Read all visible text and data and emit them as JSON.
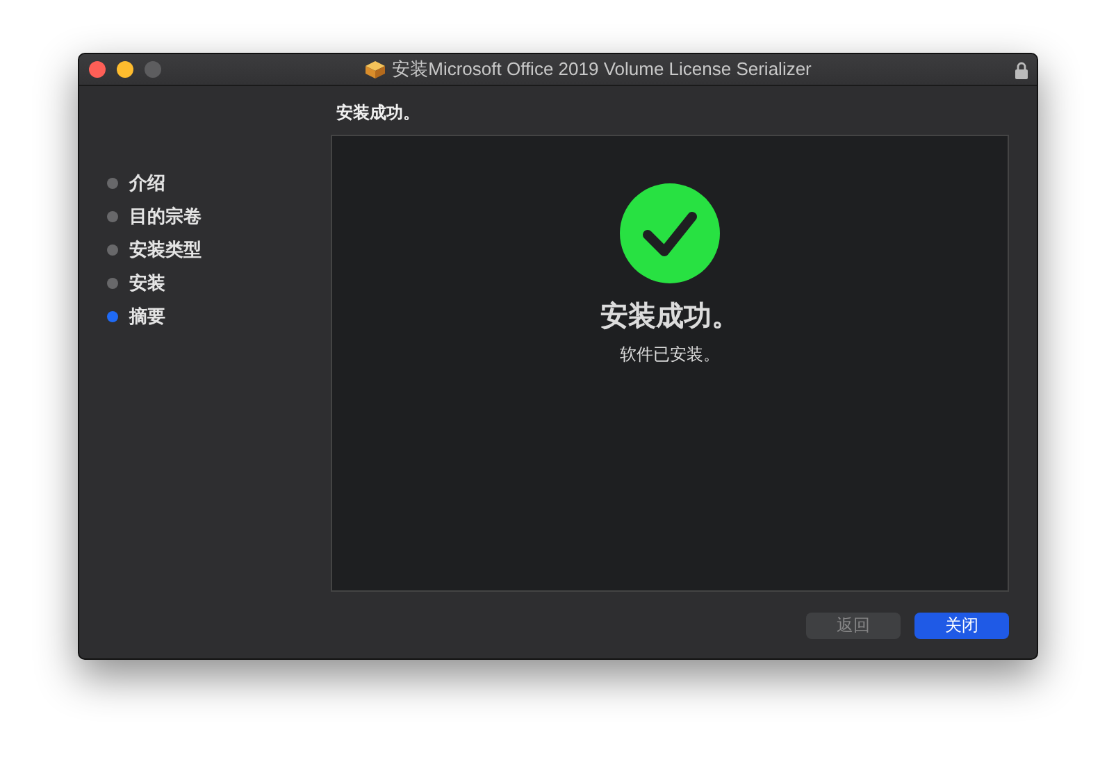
{
  "window": {
    "title": "安装Microsoft Office 2019 Volume License Serializer",
    "locked": true
  },
  "steps": [
    {
      "label": "介绍",
      "selected": false
    },
    {
      "label": "目的宗卷",
      "selected": false
    },
    {
      "label": "安装类型",
      "selected": false
    },
    {
      "label": "安装",
      "selected": false
    },
    {
      "label": "摘要",
      "selected": true
    }
  ],
  "heading": "安装成功。",
  "result": {
    "kind": "success",
    "title": "安装成功。",
    "message": "软件已安装。"
  },
  "buttons": [
    {
      "label": "返回",
      "kind": "secondary",
      "disabled": true
    },
    {
      "label": "关闭",
      "kind": "primary",
      "disabled": false
    }
  ]
}
